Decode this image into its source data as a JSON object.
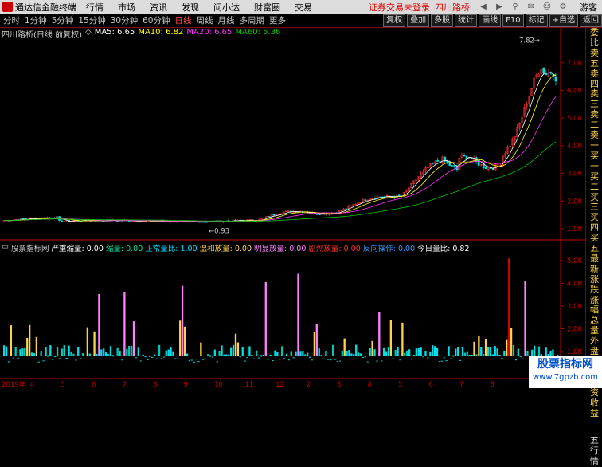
{
  "topbar": {
    "app_name": "通达信金融终端",
    "menus": [
      "行情",
      "市场",
      "资讯",
      "发现",
      "问小达",
      "财富圈",
      "交易"
    ],
    "alert": "证券交易未登录",
    "stock_name": "四川路桥",
    "guest": "游客"
  },
  "periods": {
    "items": [
      "分时",
      "1分钟",
      "5分钟",
      "15分钟",
      "30分钟",
      "60分钟",
      "日线",
      "周线",
      "月线",
      "多周期",
      "更多"
    ],
    "active": "日线",
    "right_tools": [
      "复权",
      "叠加",
      "多股",
      "统计",
      "画线",
      "F10",
      "标记",
      "+自选",
      "返回"
    ]
  },
  "info": {
    "title": "四川路桥(日线 前复权)",
    "ma5": "MA5: 6.65",
    "ma10": "MA10: 6.82",
    "ma20": "MA20: 6.65",
    "ma60": "MA60: 5.36"
  },
  "colors": {
    "ma5": "#ffffff",
    "ma10": "#ffff00",
    "ma20": "#ff33ff",
    "ma60": "#00c800",
    "up": "#ff3333",
    "down": "#00e0e0",
    "axis": "#c00000"
  },
  "price_axis": {
    "labels": [
      "7.00",
      "6.00",
      "5.00",
      "4.00",
      "3.00",
      "2.00",
      "1.00"
    ],
    "min_label": "0.93",
    "max_label": "7.82"
  },
  "date_axis": {
    "year": "2019年",
    "markers": [
      "4",
      "5",
      "6",
      "7",
      "8",
      "9",
      "10",
      "11",
      "12",
      "2",
      "3",
      "4",
      "5",
      "6",
      "7",
      "8"
    ]
  },
  "right_panel": {
    "items": [
      "委比",
      "卖五",
      "卖四",
      "卖三",
      "卖二",
      "卖一",
      "买一",
      "买二",
      "买三",
      "买四",
      "买五",
      "最新",
      "涨跌",
      "涨幅",
      "总量",
      "外盘",
      "换手",
      "净资",
      "收益"
    ],
    "bottom_items": [
      "五",
      "行",
      "情"
    ]
  },
  "indicator": {
    "name": "股票指标网",
    "fields": [
      {
        "label": "严重缩量: 0.00",
        "color": "#ffffff"
      },
      {
        "label": "缩量: 0.00",
        "color": "#00e0a0"
      },
      {
        "label": "正常量比: 1.00",
        "color": "#00e0ff"
      },
      {
        "label": "温和放量: 0.00",
        "color": "#ffd24d"
      },
      {
        "label": "明显放量: 0.00",
        "color": "#ff80ff"
      },
      {
        "label": "剧烈放量: 0.00",
        "color": "#ff3333"
      },
      {
        "label": "反向操作: 0.00",
        "color": "#3399ff"
      },
      {
        "label": "今日量比: 0.82",
        "color": "#ffffff"
      }
    ],
    "axis_labels": [
      "5.00",
      "4.00",
      "3.00",
      "2.00",
      "1.00"
    ]
  },
  "watermark": {
    "line1": "股票指标网",
    "line2": "www.7gpzb.com"
  }
}
